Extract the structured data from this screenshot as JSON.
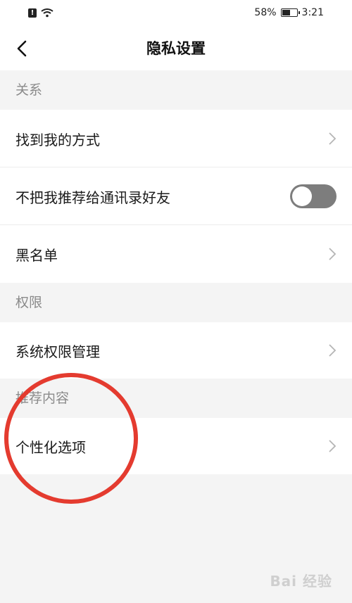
{
  "status_bar": {
    "alert_glyph": "!",
    "battery_percent": "58%",
    "battery_level": 0.58,
    "time": "3:21"
  },
  "header": {
    "title": "隐私设置"
  },
  "sections": {
    "relations": {
      "title": "关系",
      "items": {
        "find_me": "找到我的方式",
        "no_recommend": "不把我推荐给通讯录好友",
        "blacklist": "黑名单"
      },
      "no_recommend_toggle_on": false
    },
    "permissions": {
      "title": "权限",
      "items": {
        "system_permissions": "系统权限管理"
      }
    },
    "recommend": {
      "title": "推荐内容",
      "items": {
        "personalization": "个性化选项"
      }
    }
  },
  "annotation": {
    "circle_color": "#e43b2f"
  },
  "watermark": {
    "text": "Bai 经验"
  }
}
